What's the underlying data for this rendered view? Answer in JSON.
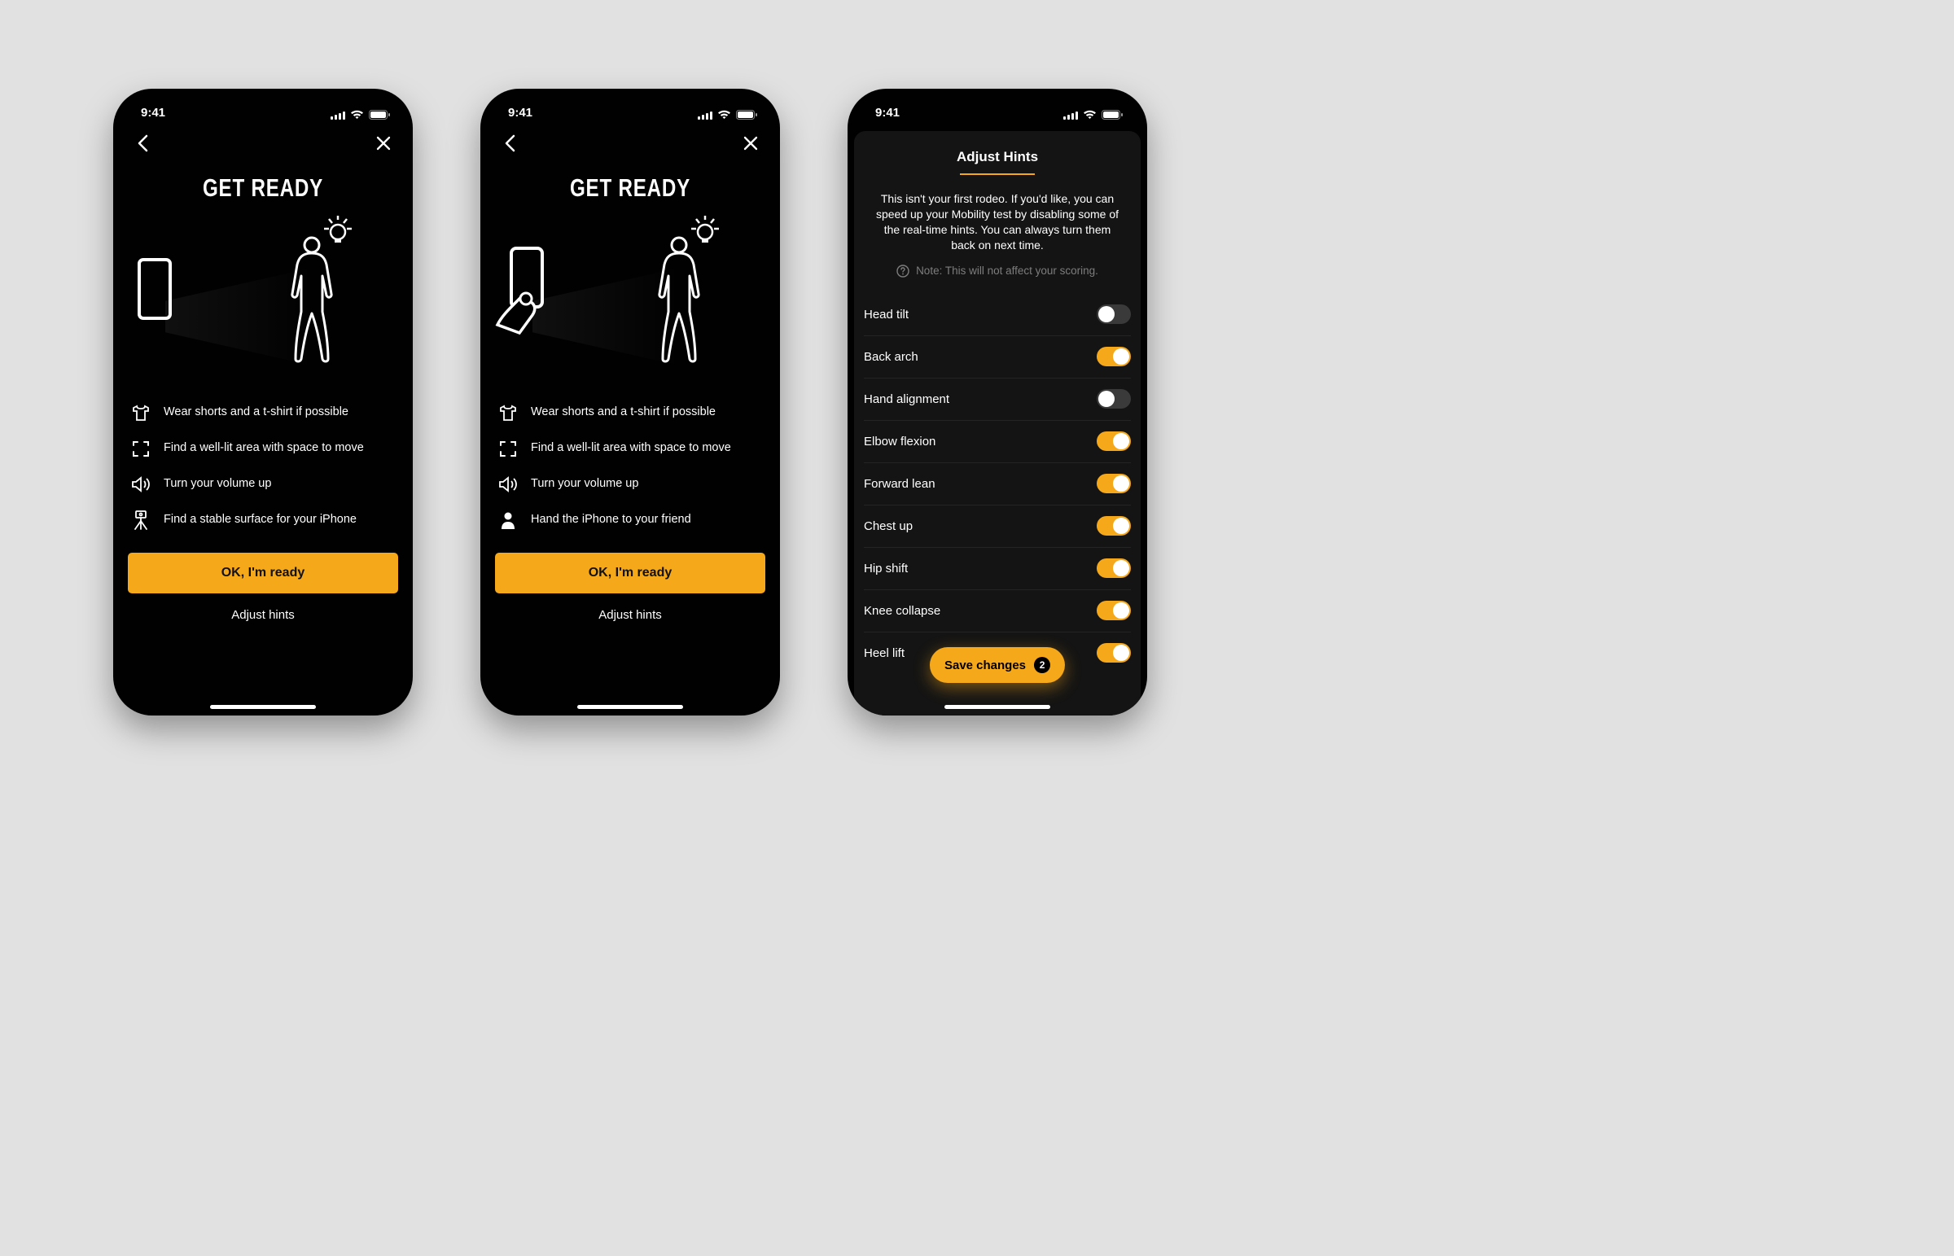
{
  "status": {
    "time": "9:41"
  },
  "screen1": {
    "title": "GET READY",
    "tips": [
      {
        "icon": "tshirt-icon",
        "label": "Wear shorts and a t-shirt if possible"
      },
      {
        "icon": "focus-icon",
        "label": "Find a well-lit area with space to move"
      },
      {
        "icon": "volume-icon",
        "label": "Turn your volume up"
      },
      {
        "icon": "tripod-icon",
        "label": "Find a stable surface for your iPhone"
      }
    ],
    "primary": "OK, I'm ready",
    "secondary": "Adjust hints"
  },
  "screen2": {
    "title": "GET READY",
    "tips": [
      {
        "icon": "tshirt-icon",
        "label": "Wear shorts and a t-shirt if possible"
      },
      {
        "icon": "focus-icon",
        "label": "Find a well-lit area with space to move"
      },
      {
        "icon": "volume-icon",
        "label": "Turn your volume up"
      },
      {
        "icon": "person-icon",
        "label": "Hand the iPhone to your friend"
      }
    ],
    "primary": "OK, I'm ready",
    "secondary": "Adjust hints"
  },
  "screen3": {
    "title": "Adjust Hints",
    "intro": "This isn't your first rodeo. If you'd like, you can speed up your Mobility test by disabling some of the real-time hints. You can always turn them back on next time.",
    "note": "Note: This will not affect your scoring.",
    "toggles": [
      {
        "label": "Head tilt",
        "on": false
      },
      {
        "label": "Back arch",
        "on": true
      },
      {
        "label": "Hand alignment",
        "on": false
      },
      {
        "label": "Elbow flexion",
        "on": true
      },
      {
        "label": "Forward lean",
        "on": true
      },
      {
        "label": "Chest up",
        "on": true
      },
      {
        "label": "Hip shift",
        "on": true
      },
      {
        "label": "Knee collapse",
        "on": true
      },
      {
        "label": "Heel lift",
        "on": true
      }
    ],
    "save": "Save changes",
    "save_count": "2"
  },
  "colors": {
    "accent": "#f5a81a"
  }
}
